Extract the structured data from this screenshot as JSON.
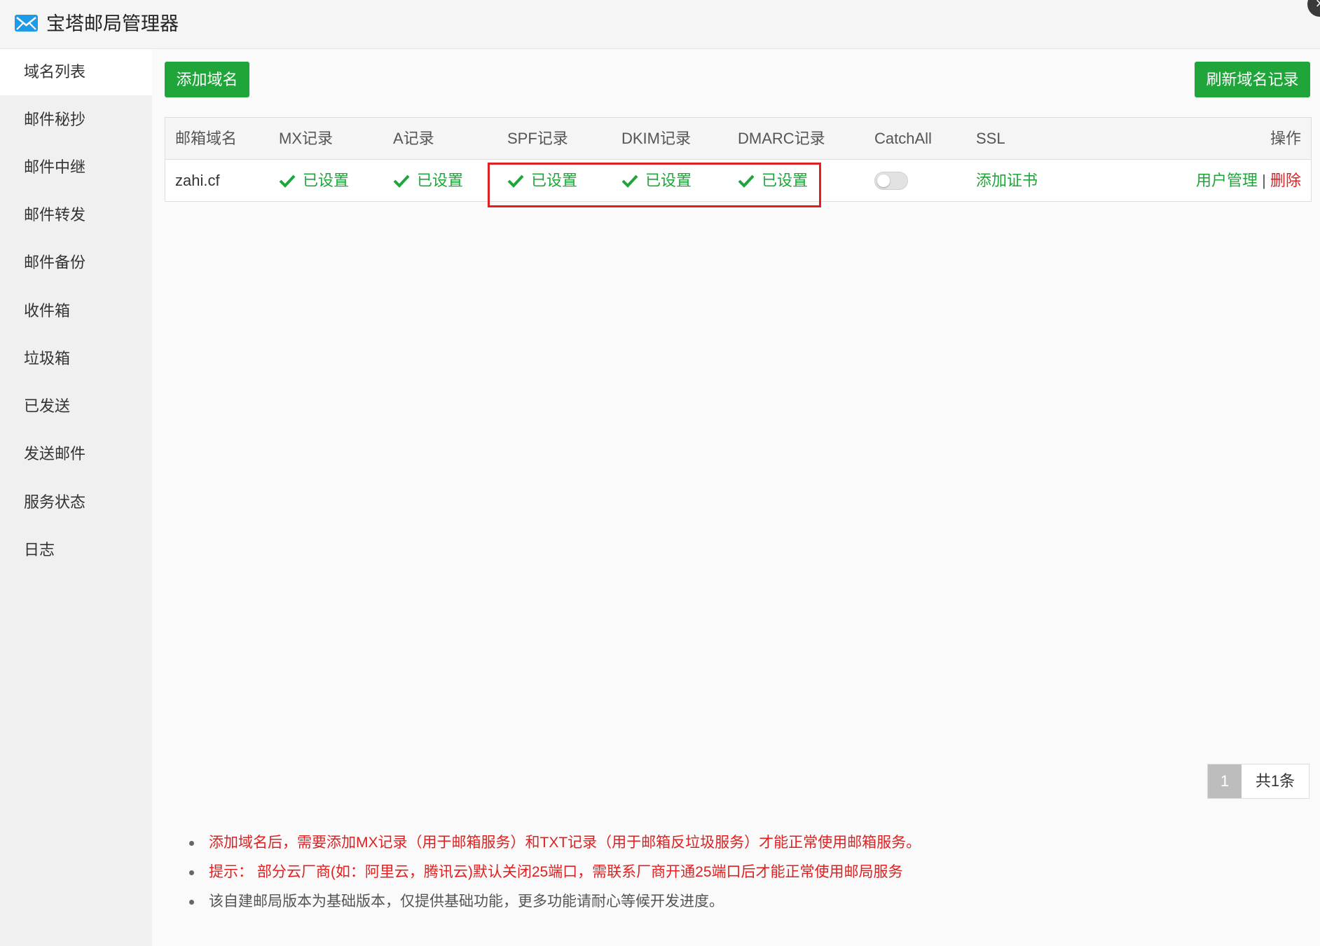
{
  "window": {
    "title": "宝塔邮局管理器",
    "close_label": "×"
  },
  "sidebar": {
    "items": [
      {
        "label": "域名列表",
        "active": true
      },
      {
        "label": "邮件秘抄"
      },
      {
        "label": "邮件中继"
      },
      {
        "label": "邮件转发"
      },
      {
        "label": "邮件备份"
      },
      {
        "label": "收件箱"
      },
      {
        "label": "垃圾箱"
      },
      {
        "label": "已发送"
      },
      {
        "label": "发送邮件"
      },
      {
        "label": "服务状态"
      },
      {
        "label": "日志"
      }
    ]
  },
  "toolbar": {
    "add_domain": "添加域名",
    "refresh_records": "刷新域名记录"
  },
  "table": {
    "headers": {
      "domain": "邮箱域名",
      "mx": "MX记录",
      "a": "A记录",
      "spf": "SPF记录",
      "dkim": "DKIM记录",
      "dmarc": "DMARC记录",
      "catchall": "CatchAll",
      "ssl": "SSL",
      "actions": "操作"
    },
    "rows": [
      {
        "domain": "zahi.cf",
        "mx": "已设置",
        "a": "已设置",
        "spf": "已设置",
        "dkim": "已设置",
        "dmarc": "已设置",
        "catchall_on": false,
        "ssl": "添加证书",
        "user_manage": "用户管理",
        "separator": "|",
        "delete": "删除"
      }
    ]
  },
  "pagination": {
    "current": "1",
    "total": "共1条"
  },
  "tips": [
    "添加域名后，需要添加MX记录（用于邮箱服务）和TXT记录（用于邮箱反垃圾服务）才能正常使用邮箱服务。",
    "提示： 部分云厂商(如：阿里云，腾讯云)默认关闭25端口，需联系厂商开通25端口后才能正常使用邮局服务",
    "该自建邮局版本为基础版本，仅提供基础功能，更多功能请耐心等候开发进度。"
  ],
  "colors": {
    "accent": "#20a53a",
    "danger": "#e02020"
  }
}
